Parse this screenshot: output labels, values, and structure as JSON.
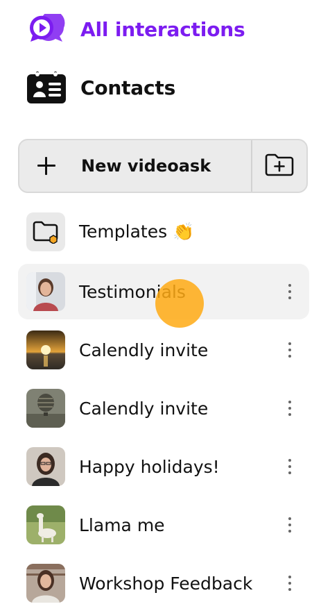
{
  "nav": {
    "all_interactions": {
      "label": "All interactions",
      "icon": "chat-play-icon",
      "color": "#7c1cf0"
    },
    "contacts": {
      "label": "Contacts",
      "icon": "contacts-book-icon"
    }
  },
  "actions": {
    "new_videoask_label": "New videoask",
    "new_icon": "plus-icon",
    "new_folder_icon": "folder-plus-icon"
  },
  "folders": [
    {
      "label": "Templates 👏",
      "icon": "folder-icon"
    },
    {
      "label": "Testimonials",
      "thumb": "woman-portrait"
    },
    {
      "label": "Calendly invite",
      "thumb": "sunset-sea"
    },
    {
      "label": "Calendly invite",
      "thumb": "hot-air-balloon"
    },
    {
      "label": "Happy holidays!",
      "thumb": "woman-glasses"
    },
    {
      "label": "Llama me",
      "thumb": "llama-field"
    },
    {
      "label": "Workshop Feedback",
      "thumb": "woman-bookshelf"
    }
  ],
  "colors": {
    "accent": "#7c1cf0",
    "pointer": "#ffaa14",
    "active_row": "#f2f2f2"
  }
}
